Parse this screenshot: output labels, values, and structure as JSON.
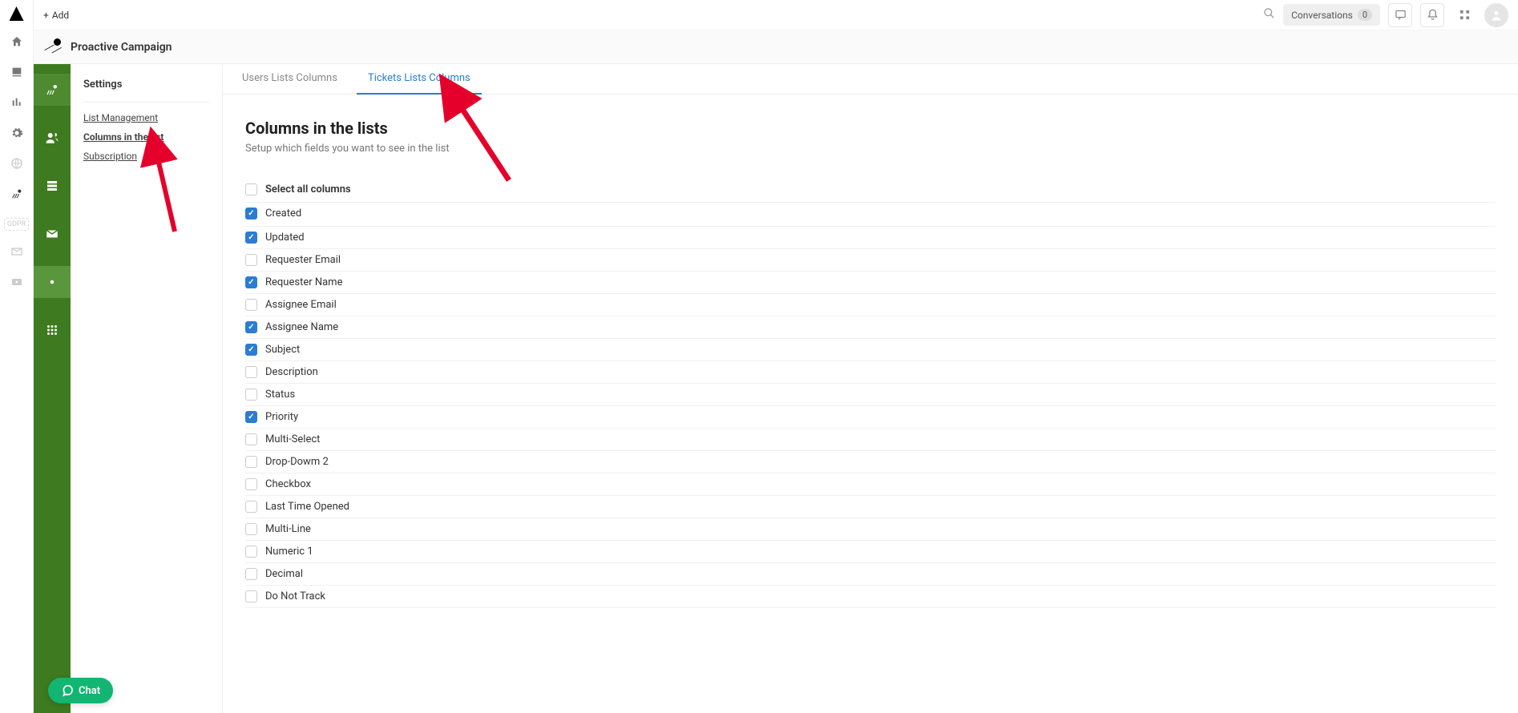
{
  "topbar": {
    "add_label": "Add",
    "conversations_label": "Conversations",
    "conversations_count": "0"
  },
  "subheader": {
    "title": "Proactive Campaign"
  },
  "settings_sidebar": {
    "heading": "Settings",
    "links": {
      "list_management": "List Management",
      "columns_in_list": "Columns in the list",
      "subscription": "Subscription"
    }
  },
  "tabs": {
    "users": "Users Lists Columns",
    "tickets": "Tickets Lists Columns"
  },
  "content": {
    "heading": "Columns in the lists",
    "subtitle": "Setup which fields you want to see in the list",
    "select_all": "Select all columns"
  },
  "columns": [
    {
      "label": "Created",
      "checked": true
    },
    {
      "label": "Updated",
      "checked": true
    },
    {
      "label": "Requester Email",
      "checked": false
    },
    {
      "label": "Requester Name",
      "checked": true
    },
    {
      "label": "Assignee Email",
      "checked": false
    },
    {
      "label": "Assignee Name",
      "checked": true
    },
    {
      "label": "Subject",
      "checked": true
    },
    {
      "label": "Description",
      "checked": false
    },
    {
      "label": "Status",
      "checked": false
    },
    {
      "label": "Priority",
      "checked": true
    },
    {
      "label": "Multi-Select",
      "checked": false
    },
    {
      "label": "Drop-Dowm 2",
      "checked": false
    },
    {
      "label": "Checkbox",
      "checked": false
    },
    {
      "label": "Last Time Opened",
      "checked": false
    },
    {
      "label": "Multi-Line",
      "checked": false
    },
    {
      "label": "Numeric 1",
      "checked": false
    },
    {
      "label": "Decimal",
      "checked": false
    },
    {
      "label": "Do Not Track",
      "checked": false
    }
  ],
  "chat": {
    "label": "Chat"
  }
}
